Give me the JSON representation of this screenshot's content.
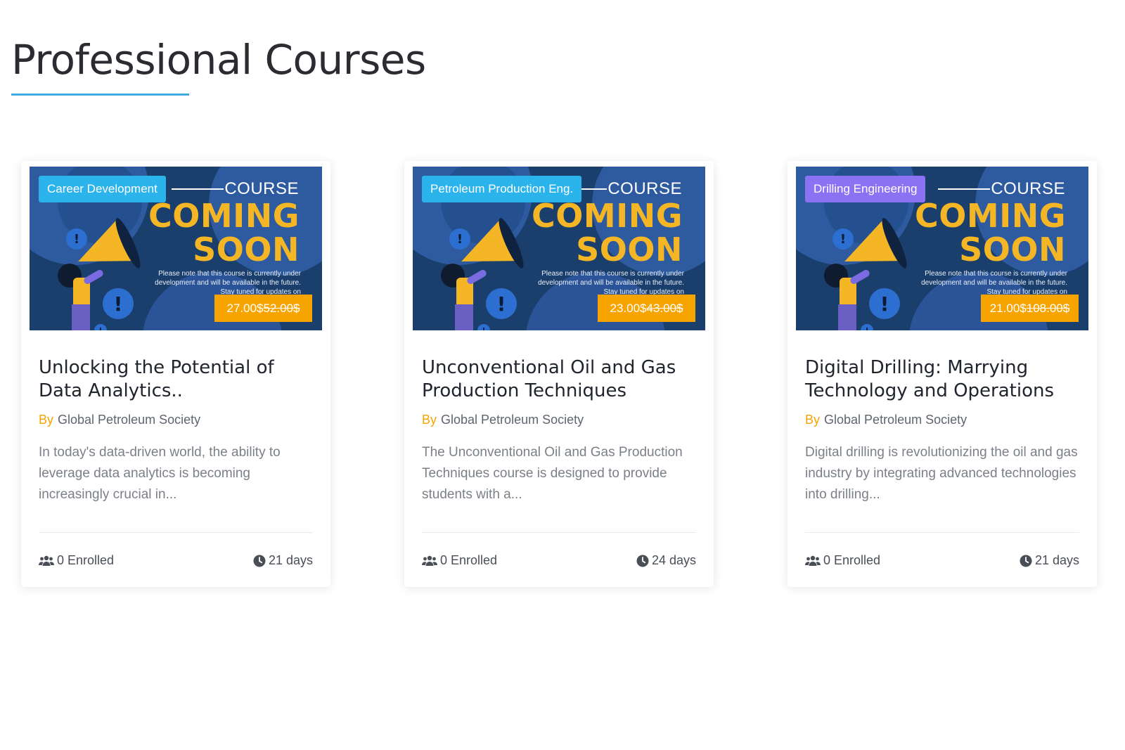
{
  "page": {
    "title": "Professional Courses",
    "accent_color": "#3fa9e0"
  },
  "courses": [
    {
      "category": "Career Development",
      "category_color": "#2bb3ec",
      "banner": {
        "course_word": "COURSE",
        "coming": "COMING",
        "soon": "SOON",
        "note": "Please note that this course is currently under development and will be available in the future. Stay tuned for updates on"
      },
      "price_current": "27.00$",
      "price_original": "52.00$",
      "title": "Unlocking the Potential of Data Analytics..",
      "by_label": "By",
      "author": "Global Petroleum Society",
      "description": "In today's data-driven world, the ability to leverage data analytics is becoming increasingly crucial in...",
      "enrolled": "0 Enrolled",
      "duration": "21 days",
      "enrolled_icon": "users-icon",
      "duration_icon": "clock-icon"
    },
    {
      "category": "Petroleum Production Eng.",
      "category_color": "#2bb3ec",
      "banner": {
        "course_word": "COURSE",
        "coming": "COMING",
        "soon": "SOON",
        "note": "Please note that this course is currently under development and will be available in the future. Stay tuned for updates on"
      },
      "price_current": "23.00$",
      "price_original": "43.00$",
      "title": "Unconventional Oil and Gas Production Techniques",
      "by_label": "By",
      "author": "Global Petroleum Society",
      "description": "The Unconventional Oil and Gas Production Techniques course is designed to provide students with a...",
      "enrolled": "0 Enrolled",
      "duration": "24 days",
      "enrolled_icon": "users-icon",
      "duration_icon": "clock-icon"
    },
    {
      "category": "Drilling Engineering",
      "category_color": "#8b72f2",
      "banner": {
        "course_word": "COURSE",
        "coming": "COMING",
        "soon": "SOON",
        "note": "Please note that this course is currently under development and will be available in the future. Stay tuned for updates on"
      },
      "price_current": "21.00$",
      "price_original": "108.00$",
      "title": "Digital Drilling: Marrying Technology and Operations",
      "by_label": "By",
      "author": "Global Petroleum Society",
      "description": "Digital drilling is revolutionizing the oil and gas industry by integrating advanced technologies into drilling...",
      "enrolled": "0 Enrolled",
      "duration": "21 days",
      "enrolled_icon": "users-icon",
      "duration_icon": "clock-icon"
    }
  ]
}
